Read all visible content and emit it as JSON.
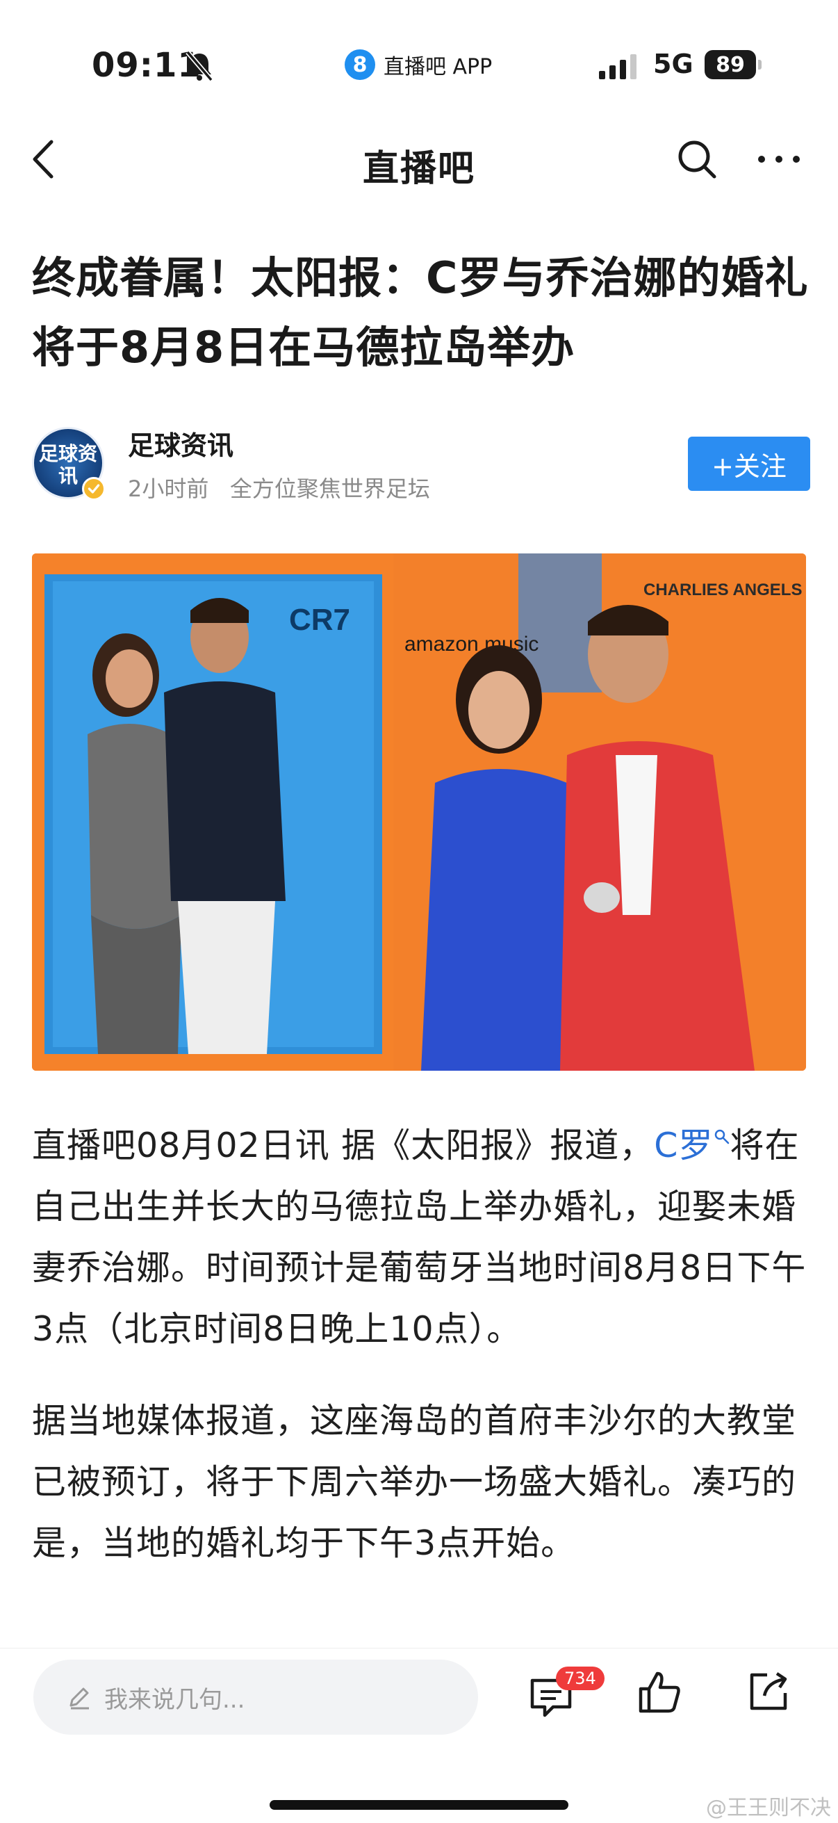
{
  "status_bar": {
    "time": "09:11",
    "app_source_badge": "8",
    "app_source_name": "直播吧 APP",
    "network": "5G",
    "battery": "89"
  },
  "nav": {
    "title": "直播吧"
  },
  "article": {
    "headline": "终成眷属！太阳报：C罗与乔治娜的婚礼将于8月8日在马德拉岛举办",
    "author": {
      "name": "足球资讯",
      "avatar_text": "足球资讯",
      "time_ago": "2小时前",
      "tagline": "全方位聚焦世界足坛",
      "follow_label": "+关注"
    },
    "hero_image": {
      "left_panel_brand": "CR7",
      "right_panel_brand_1": "amazon music",
      "right_panel_brand_2": "CHARLIES ANGELS"
    },
    "paragraph_1": {
      "prefix": "直播吧08月02日讯  据《太阳报》报道，",
      "link": "C罗",
      "rest": "将在自己出生并长大的马德拉岛上举办婚礼，迎娶未婚妻乔治娜。时间预计是葡萄牙当地时间8月8日下午3点（北京时间8日晚上10点）。"
    },
    "paragraph_2": "据当地媒体报道，这座海岛的首府丰沙尔的大教堂已被预订，将于下周六举办一场盛大婚礼。凑巧的是，当地的婚礼均于下午3点开始。"
  },
  "bottom_bar": {
    "comment_placeholder": "我来说几句...",
    "comment_count": "734",
    "watermark": "@王王则不决"
  },
  "colors": {
    "accent": "#2b8df2",
    "link": "#2b6fd6",
    "badge_red": "#ef3b3b"
  }
}
